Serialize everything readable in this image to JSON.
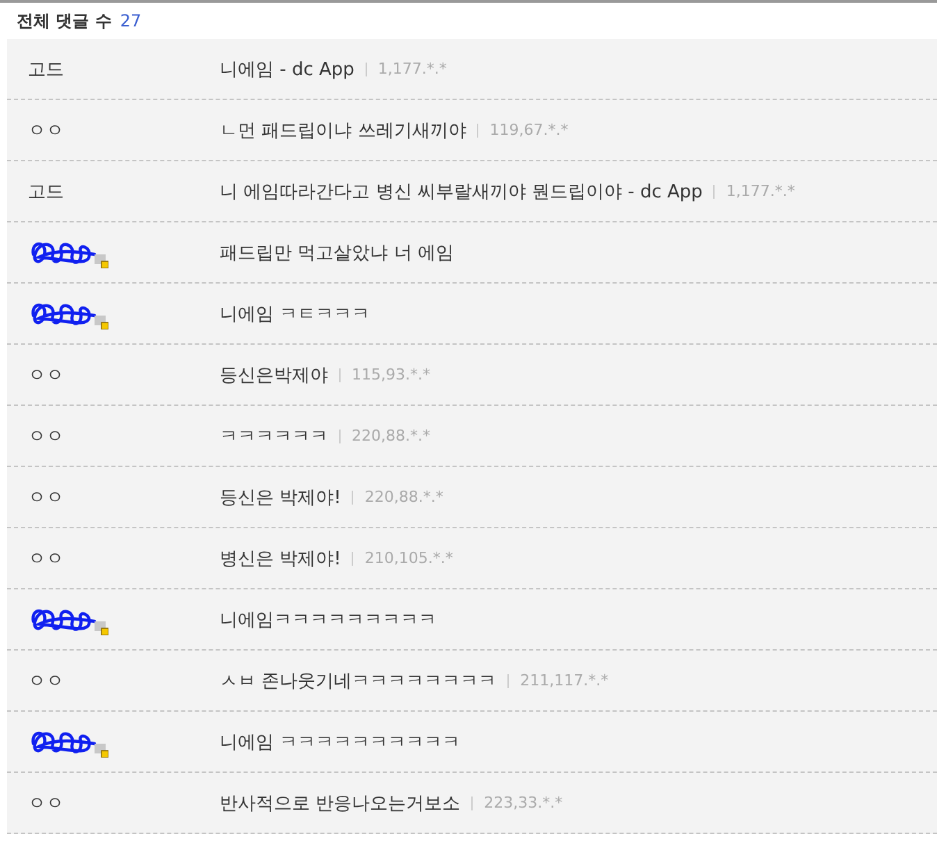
{
  "header": {
    "label": "전체 댓글 수",
    "count": "27"
  },
  "comments": [
    {
      "author": {
        "kind": "text",
        "name": "고드"
      },
      "text": "니에임 - dc App",
      "ip": "1,177.*.*"
    },
    {
      "author": {
        "kind": "text",
        "name": "ㅇㅇ"
      },
      "text": "ㄴ먼 패드립이냐 쓰레기새끼야",
      "ip": "119,67.*.*"
    },
    {
      "author": {
        "kind": "text",
        "name": "고드"
      },
      "text": "니 에임따라간다고 병신 씨부랄새끼야 뭔드립이야 - dc App",
      "ip": "1,177.*.*"
    },
    {
      "author": {
        "kind": "redacted"
      },
      "text": "패드립만 먹고살았냐 너 에임"
    },
    {
      "author": {
        "kind": "redacted"
      },
      "text": "니에임 ㅋㅌㅋㅋㅋ"
    },
    {
      "author": {
        "kind": "text",
        "name": "ㅇㅇ"
      },
      "text": "등신은박제야",
      "ip": "115,93.*.*"
    },
    {
      "author": {
        "kind": "text",
        "name": "ㅇㅇ"
      },
      "text": "ㅋㅋㅋㅋㅋㅋ",
      "ip": "220,88.*.*"
    },
    {
      "author": {
        "kind": "text",
        "name": "ㅇㅇ"
      },
      "text": "등신은 박제야!",
      "ip": "220,88.*.*"
    },
    {
      "author": {
        "kind": "text",
        "name": "ㅇㅇ"
      },
      "text": "병신은 박제야!",
      "ip": "210,105.*.*"
    },
    {
      "author": {
        "kind": "redacted"
      },
      "text": "니에임ㅋㅋㅋㅋㅋㅋㅋㅋㅋ"
    },
    {
      "author": {
        "kind": "text",
        "name": "ㅇㅇ"
      },
      "text": "ㅅㅂ 존나웃기네ㅋㅋㅋㅋㅋㅋㅋㅋ",
      "ip": "211,117.*.*"
    },
    {
      "author": {
        "kind": "redacted"
      },
      "text": "니에임 ㅋㅋㅋㅋㅋㅋㅋㅋㅋㅋ"
    },
    {
      "author": {
        "kind": "text",
        "name": "ㅇㅇ"
      },
      "text": "반사적으로 반응나오는거보소",
      "ip": "223,33.*.*"
    }
  ]
}
